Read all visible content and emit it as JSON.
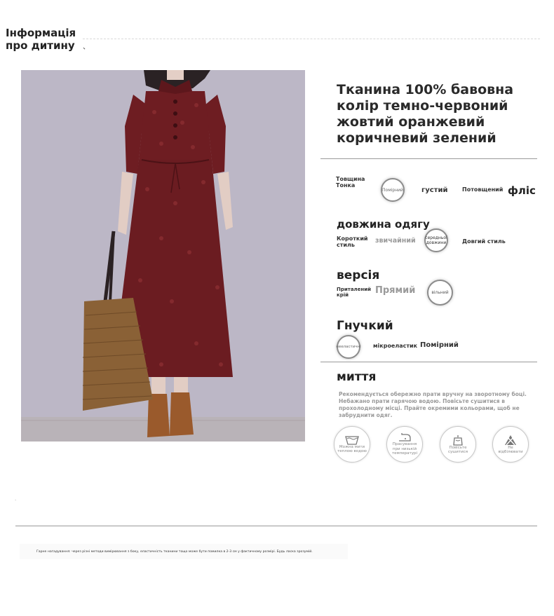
{
  "header": {
    "title_line1": "Інформація",
    "title_line2": "про дитину",
    "tick": "、"
  },
  "photo": {
    "description_icon": "dress-photo",
    "colors": {
      "background": "#bcb7c6",
      "dress": "#6e1d22",
      "floor": "#b9b3b8",
      "bag": "#8a6136",
      "boots": "#9a5a2c"
    }
  },
  "fabric": {
    "line1": "Тканина 100% бавовна",
    "line2": "колір темно-червоний",
    "line3": "жовтий оранжевий",
    "line4": "коричневий зелений"
  },
  "thickness": {
    "label_top": "Товщина",
    "label_bottom": "Тонка",
    "opt_selected": "Помірний",
    "opt_dense": "густий",
    "opt_thick": "Потовщений",
    "opt_fleece": "фліс"
  },
  "length": {
    "title": "довжина одягу",
    "opt_short_1": "Короткий",
    "opt_short_2": "стиль",
    "opt_normal": "звичайний",
    "opt_selected_1": "середньої",
    "opt_selected_2": "довжини",
    "opt_long": "Довгий стиль"
  },
  "version": {
    "title": "версія",
    "opt_fit_1": "Приталений",
    "opt_fit_2": "крій",
    "opt_straight": "Прямий",
    "opt_selected": "вільний"
  },
  "elastic": {
    "title": "Гнучкий",
    "opt_selected": "нееластичні",
    "opt_micro": "мікроеластик",
    "opt_moderate": "Помірний"
  },
  "washing": {
    "title": "миття",
    "text": "Рекомендується обережно прати вручну на зворотному боці. Небажано прати гарячою водою. Повісьте сушитися в прохолодному місці. Прайте окремими кольорами, щоб не забруднити одяг.",
    "icons": [
      {
        "icon": "wash-basin-icon",
        "label": "Можна мити теплою водою"
      },
      {
        "icon": "iron-icon",
        "label": "Прасування при низькій температурі"
      },
      {
        "icon": "hang-dry-icon",
        "label": "Повісьте сушитися"
      },
      {
        "icon": "no-bleach-icon",
        "label": "Не відбілювати"
      }
    ]
  },
  "footnote": {
    "text": "Гарне нагадування: через різні методи вимірювання з боку, еластичність тканини тощо може бути помилка в 2-3 см у фактичному розмірі. Будь ласка зрозумій."
  },
  "stray_mark": "."
}
